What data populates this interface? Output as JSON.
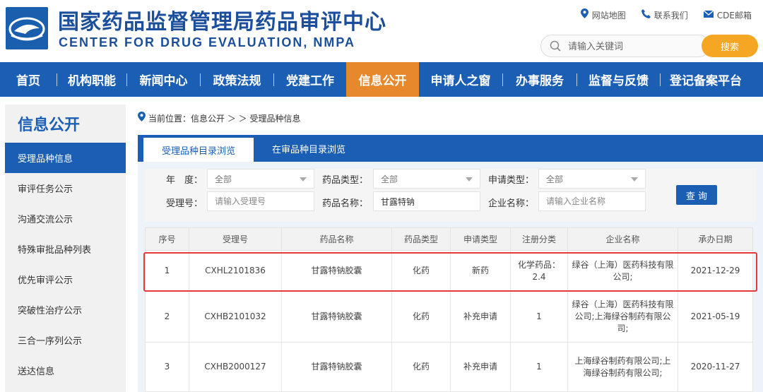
{
  "header": {
    "title_cn": "国家药品监督管理局药品审评中心",
    "title_en": "CENTER FOR DRUG EVALUATION, NMPA",
    "toplinks": [
      {
        "label": "网站地图",
        "icon": "location-pin-icon"
      },
      {
        "label": "联系我们",
        "icon": "phone-icon"
      },
      {
        "label": "CDE邮箱",
        "icon": "mail-icon"
      }
    ],
    "search_placeholder": "请输入关键词",
    "search_button": "搜索"
  },
  "nav": {
    "items": [
      "首页",
      "机构职能",
      "新闻中心",
      "政策法规",
      "党建工作",
      "信息公开",
      "申请人之窗",
      "办事服务",
      "监督与反馈",
      "登记备案平台"
    ],
    "active": "信息公开"
  },
  "sidebar": {
    "title": "信息公开",
    "items": [
      "受理品种信息",
      "审评任务公示",
      "沟通交流公示",
      "特殊审批品种列表",
      "优先审评公示",
      "突破性治疗公示",
      "三合一序列公示",
      "送达信息"
    ]
  },
  "breadcrumb": {
    "text": "当前位置：信息公开 ＞ ＞ 受理品种信息"
  },
  "tabs": [
    "受理品种目录浏览",
    "在审品种目录浏览"
  ],
  "filters": {
    "year_label": "年　度：",
    "year_value": "全部",
    "drug_type_label": "药品类型：",
    "drug_type_value": "全部",
    "apply_type_label": "申请类型：",
    "apply_type_value": "全部",
    "accept_no_label": "受理号：",
    "accept_no_placeholder": "请输入受理号",
    "drug_name_label": "药品名称：",
    "drug_name_value": "甘露特钠",
    "company_label": "企业名称：",
    "company_placeholder": "请输入企业名称",
    "query_button": "查 询"
  },
  "table": {
    "columns": [
      "序号",
      "受理号",
      "药品名称",
      "药品类型",
      "申请类型",
      "注册分类",
      "企业名称",
      "承办日期"
    ],
    "rows": [
      [
        "1",
        "CXHL2101836",
        "甘露特钠胶囊",
        "化药",
        "新药",
        "化学药品：2.4",
        "绿谷（上海）医药科技有限公司;",
        "2021-12-29"
      ],
      [
        "2",
        "CXHB2101032",
        "甘露特钠胶囊",
        "化药",
        "补充申请",
        "1",
        "绿谷（上海）医药科技有限公司;上海绿谷制药有限公司;",
        "2021-05-19"
      ],
      [
        "3",
        "CXHB2000127",
        "甘露特钠胶囊",
        "化药",
        "补充申请",
        "1",
        "上海绿谷制药有限公司;上海绿谷制药有限公司;",
        "2020-11-27"
      ]
    ]
  },
  "colors": {
    "primary": "#1b5fb5",
    "accent": "#e8882d",
    "search_button": "#f5a623",
    "highlight": "#e53935"
  }
}
